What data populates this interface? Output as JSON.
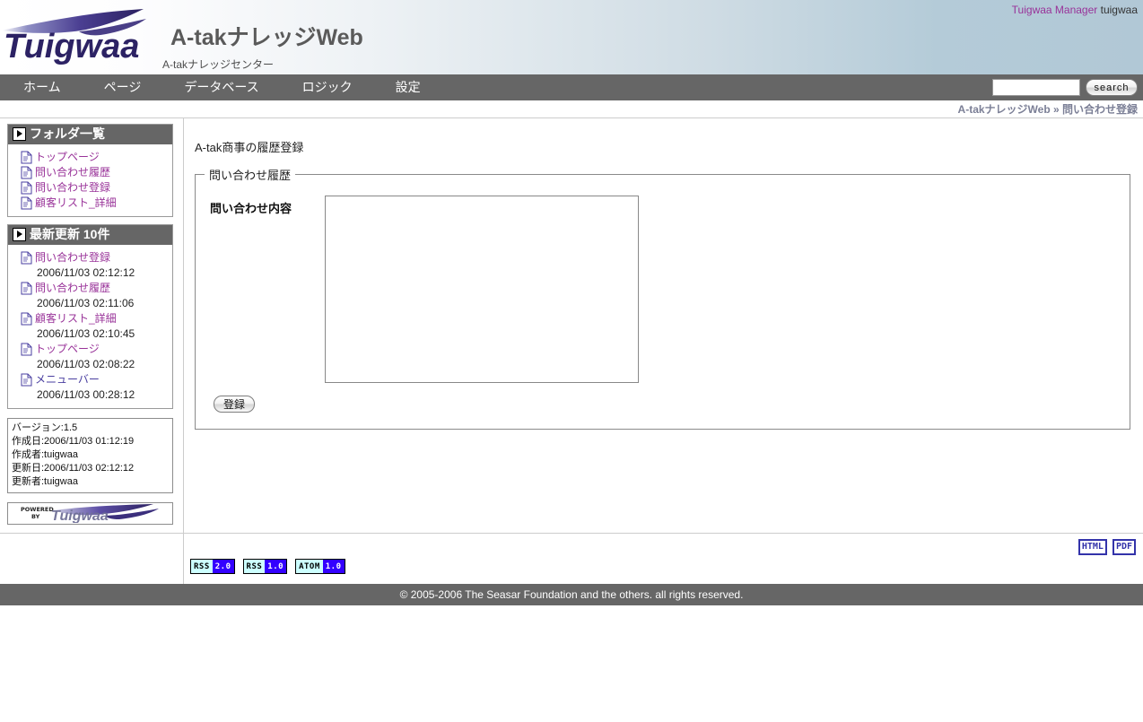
{
  "header": {
    "user_role": "Tuigwaa Manager",
    "user_name": "tuigwaa",
    "site_title": "A-takナレッジWeb",
    "site_subtitle": "A-takナレッジセンター",
    "logo_text": "Tuigwaa"
  },
  "nav": {
    "items": [
      {
        "label": "ホーム"
      },
      {
        "label": "ページ"
      },
      {
        "label": "データベース"
      },
      {
        "label": "ロジック"
      },
      {
        "label": "設定"
      }
    ],
    "search_value": "",
    "search_placeholder": "",
    "search_button": "search"
  },
  "breadcrumb": {
    "text": "A-takナレッジWeb » 問い合わせ登録"
  },
  "sidebar": {
    "folder_panel": {
      "title": "フォルダ一覧",
      "items": [
        {
          "label": "トップページ",
          "color": "magenta"
        },
        {
          "label": "問い合わせ履歴",
          "color": "magenta"
        },
        {
          "label": "問い合わせ登録",
          "color": "magenta"
        },
        {
          "label": "顧客リスト_詳細",
          "color": "magenta"
        }
      ]
    },
    "recent_panel": {
      "title": "最新更新 10件",
      "items": [
        {
          "label": "問い合わせ登録",
          "date": "2006/11/03 02:12:12",
          "color": "magenta"
        },
        {
          "label": "問い合わせ履歴",
          "date": "2006/11/03 02:11:06",
          "color": "magenta"
        },
        {
          "label": "顧客リスト_詳細",
          "date": "2006/11/03 02:10:45",
          "color": "magenta"
        },
        {
          "label": "トップページ",
          "date": "2006/11/03 02:08:22",
          "color": "magenta"
        },
        {
          "label": "メニューバー",
          "date": "2006/11/03 00:28:12",
          "color": "blue"
        }
      ]
    },
    "info": {
      "lines": [
        "バージョン:1.5",
        "作成日:2006/11/03 01:12:19",
        "作成者:tuigwaa",
        "更新日:2006/11/03 02:12:12",
        "更新者:tuigwaa"
      ]
    },
    "powered_by": {
      "prefix": "POWERED",
      "by": "BY",
      "brand": "Tuigwaa"
    }
  },
  "main": {
    "page_heading": "A-tak商事の履歴登録",
    "fieldset_legend": "問い合わせ履歴",
    "field_label": "問い合わせ内容",
    "field_value": "",
    "field_placeholder": "",
    "submit_label": "登録"
  },
  "footer": {
    "feeds": [
      {
        "left": "RSS",
        "right": "2.0"
      },
      {
        "left": "RSS",
        "right": "1.0"
      },
      {
        "left": "ATOM",
        "right": "1.0"
      }
    ],
    "exports": [
      {
        "label": "HTML"
      },
      {
        "label": "PDF"
      }
    ],
    "copyright": "© 2005-2006 The Seasar Foundation and the others. all rights reserved."
  },
  "colors": {
    "nav_bg": "#666666",
    "link_magenta": "#993399",
    "link_blue": "#4a3fa0",
    "header_blue": "#b1c8d6",
    "badge_blue": "#3300ff",
    "badge_cyan": "#ccffff",
    "export_border": "#3333aa"
  }
}
